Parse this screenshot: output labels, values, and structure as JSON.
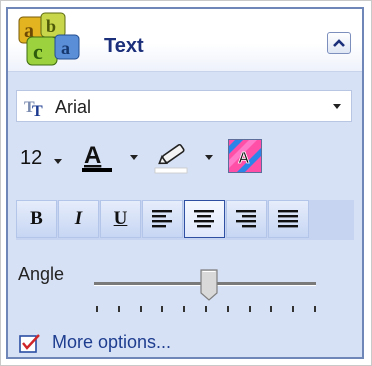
{
  "header": {
    "title": "Text",
    "logo_icon": "abc-blocks-logo-icon",
    "collapse_icon": "chevron-up-icon"
  },
  "font": {
    "name": "Arial",
    "icon": "truetype-font-icon"
  },
  "size": {
    "value": "12"
  },
  "colors": {
    "font_color": "#000000",
    "highlight_color": "#ffffff",
    "panel_bg": "#d7e1f5",
    "title_color": "#1b2f7a",
    "link_color": "#1e3d8f"
  },
  "format_buttons": {
    "bold": "B",
    "italic": "I",
    "underline": "U",
    "align": [
      "align-left-icon",
      "align-center-icon",
      "align-right-icon",
      "justify-icon"
    ],
    "active": "align-center-icon"
  },
  "angle": {
    "label": "Angle",
    "value_fraction": 0.52
  },
  "more_options": {
    "label": "More options..."
  }
}
